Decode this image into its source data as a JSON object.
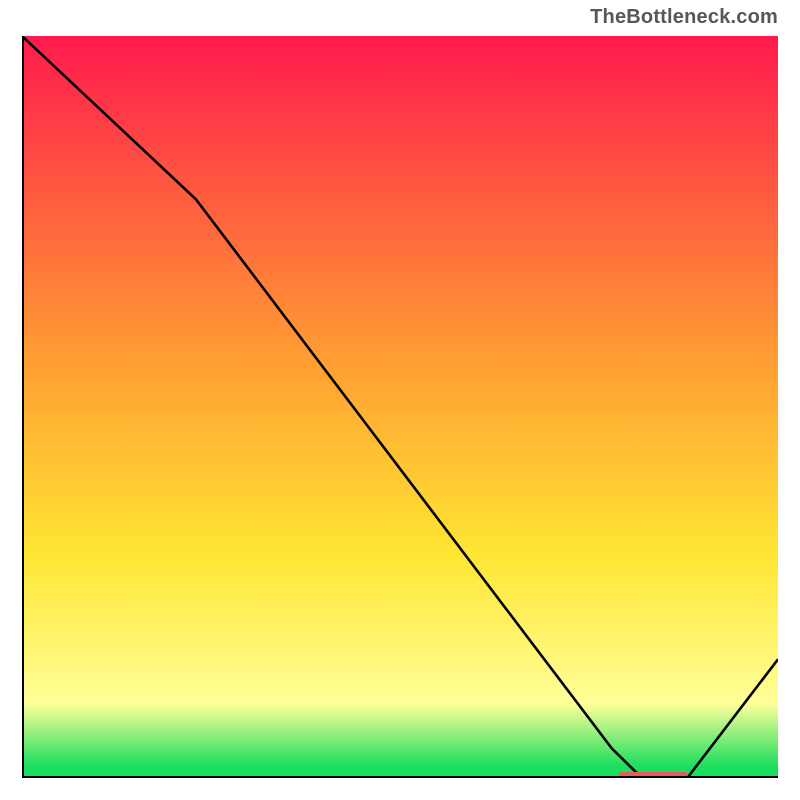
{
  "attribution": "TheBottleneck.com",
  "colors": {
    "top_red": "#ff1a4d",
    "mid_orange": "#ff9933",
    "yellow": "#ffe633",
    "pale": "#ffff99",
    "green": "#1ade5e",
    "axis": "#000000",
    "curve": "#000000",
    "marker": "#e65c5c",
    "attr_text": "#575757"
  },
  "chart_data": {
    "type": "line",
    "xlabel": "",
    "ylabel": "",
    "title": "",
    "xlim": [
      0,
      100
    ],
    "ylim": [
      0,
      100
    ],
    "x": [
      0,
      23,
      78,
      82,
      88,
      100
    ],
    "values": [
      100,
      78,
      4,
      0,
      0,
      16
    ],
    "marker": {
      "x_start": 79,
      "x_end": 88,
      "y": 0
    },
    "gradient_stops": [
      {
        "offset": 0.0,
        "color": "top_red"
      },
      {
        "offset": 0.42,
        "color": "mid_orange"
      },
      {
        "offset": 0.7,
        "color": "yellow"
      },
      {
        "offset": 0.9,
        "color": "pale"
      },
      {
        "offset": 0.985,
        "color": "green"
      },
      {
        "offset": 1.0,
        "color": "green"
      }
    ]
  }
}
